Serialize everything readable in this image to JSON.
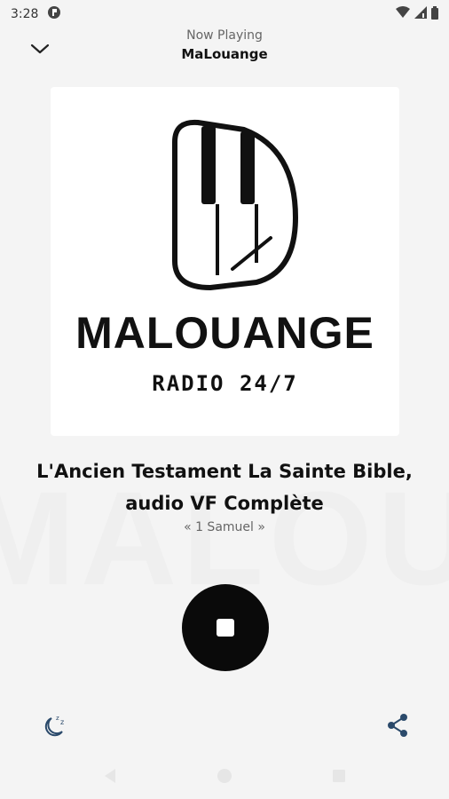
{
  "status_bar": {
    "time": "3:28"
  },
  "header": {
    "subtitle": "Now Playing",
    "title": "MaLouange"
  },
  "artwork": {
    "name": "MALOUANGE",
    "tagline": "RADIO 24/7"
  },
  "background_watermark": "MALOUANGE",
  "track": {
    "title": "L'Ancien Testament   La Sainte Bible, audio VF Complète",
    "subtitle": "« 1 Samuel »"
  },
  "controls": {
    "playback_state": "playing"
  },
  "colors": {
    "background": "#f4f4f4",
    "primary": "#0a0a0a",
    "share_icon": "#2b4a6b",
    "sleep_icon": "#2b4a6b"
  },
  "icons": {
    "collapse": "chevron-down-icon",
    "stop": "stop-icon",
    "sleep_timer": "sleep-timer-icon",
    "share": "share-icon"
  }
}
